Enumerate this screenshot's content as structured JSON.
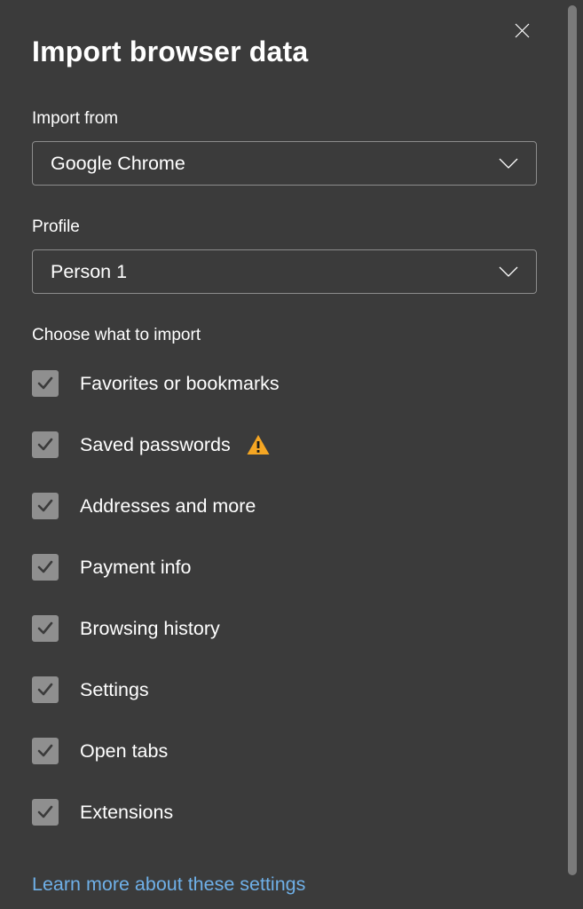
{
  "title": "Import browser data",
  "importFrom": {
    "label": "Import from",
    "value": "Google Chrome"
  },
  "profile": {
    "label": "Profile",
    "value": "Person 1"
  },
  "chooseLabel": "Choose what to import",
  "items": [
    {
      "label": "Favorites or bookmarks",
      "checked": true,
      "warning": false
    },
    {
      "label": "Saved passwords",
      "checked": true,
      "warning": true
    },
    {
      "label": "Addresses and more",
      "checked": true,
      "warning": false
    },
    {
      "label": "Payment info",
      "checked": true,
      "warning": false
    },
    {
      "label": "Browsing history",
      "checked": true,
      "warning": false
    },
    {
      "label": "Settings",
      "checked": true,
      "warning": false
    },
    {
      "label": "Open tabs",
      "checked": true,
      "warning": false
    },
    {
      "label": "Extensions",
      "checked": true,
      "warning": false
    }
  ],
  "learnMore": "Learn more about these settings"
}
